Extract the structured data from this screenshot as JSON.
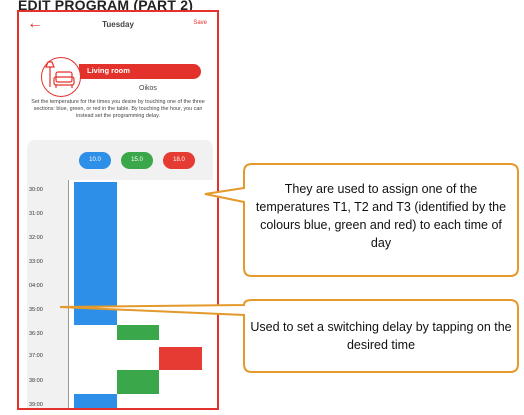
{
  "page": {
    "title": "EDIT PROGRAM (PART 2)"
  },
  "app": {
    "header": {
      "back_icon": "arrow-left-icon",
      "day": "Tuesday",
      "save": "Save"
    },
    "room": {
      "icon": "armchair-lamp-icon",
      "name": "Living room",
      "zone": "Oikos"
    },
    "instructions": "Set the temperature for the times you desire by touching one of the three sections: blue, green, or red in the table. By touching the hour, you can instead set the programming delay.",
    "temperatures": [
      {
        "label": "10.0",
        "color": "#2e8fe8"
      },
      {
        "label": "15.0",
        "color": "#3aa84a"
      },
      {
        "label": "18.0",
        "color": "#e63b33"
      }
    ],
    "times": [
      "30:00",
      "31:00",
      "32:00",
      "33:00",
      "04:00",
      "35:00",
      "36:30",
      "37:00",
      "38:00",
      "39:00"
    ]
  },
  "callouts": [
    {
      "text": "They are used to assign one of the temperatures T1, T2 and T3 (identified by the colours blue, green and red) to each time of day"
    },
    {
      "text": "Used to set a switching delay by tapping on the desired time"
    }
  ],
  "colors": {
    "accent": "#e3322b",
    "callout_border": "#e39a2b",
    "blue": "#2e8fe8",
    "green": "#3aa84a",
    "red": "#e63b33"
  }
}
